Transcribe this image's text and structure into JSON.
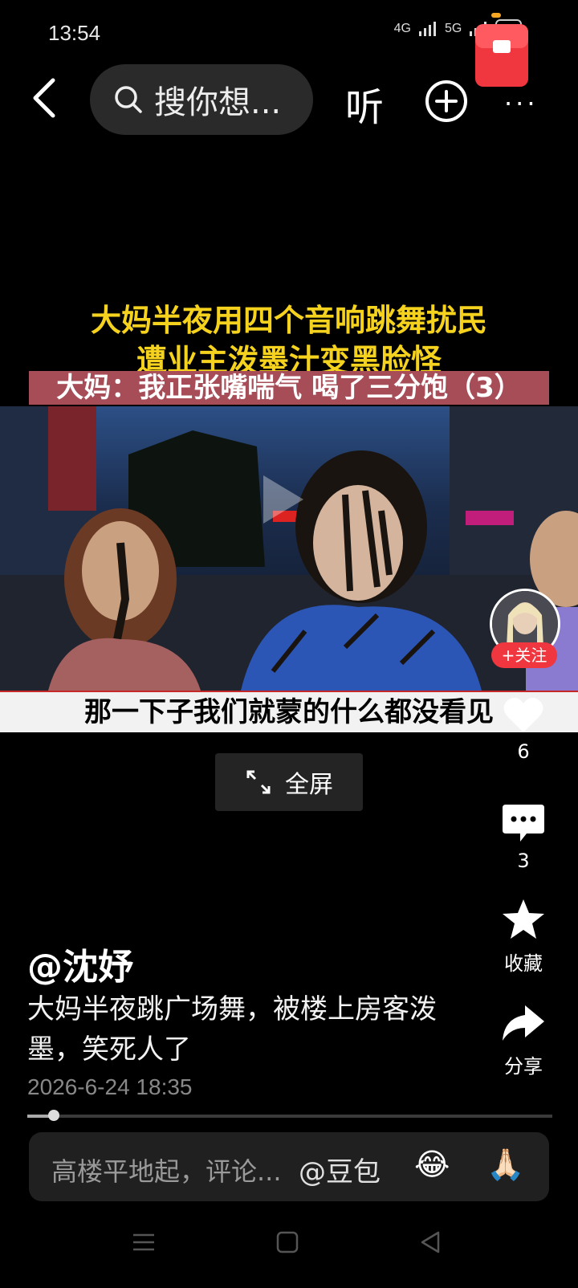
{
  "status": {
    "time": "13:54",
    "network1": "4G",
    "network2": "5G",
    "battery": "76"
  },
  "topbar": {
    "search_placeholder": "搜你想...",
    "listen_label": "听"
  },
  "video": {
    "title_line1": "大妈半夜用四个音响跳舞扰民",
    "title_line2": "遭业主泼墨汁变黑脸怪",
    "title_line3": "大妈：我正张嘴喘气 喝了三分饱（3）",
    "subtitle": "那一下子我们就蒙的什么都没看见",
    "fullscreen_label": "全屏"
  },
  "author_follow": "+关注",
  "actions": {
    "like_count": "6",
    "comment_count": "3",
    "favorite_label": "收藏",
    "share_label": "分享"
  },
  "post": {
    "author": "@沈妤",
    "description": "大妈半夜跳广场舞，被楼上房客泼墨，笑死人了",
    "date": "2026-6-24 18:35",
    "progress": 0.05
  },
  "comment_bar": {
    "placeholder": "高楼平地起，评论...",
    "mention": "@豆包",
    "emoji1": "😂",
    "emoji2": "🙏🏻"
  },
  "colors": {
    "title_yellow": "#f5d21e",
    "follow_red": "#f0363e",
    "banner_red": "#a74d58"
  }
}
